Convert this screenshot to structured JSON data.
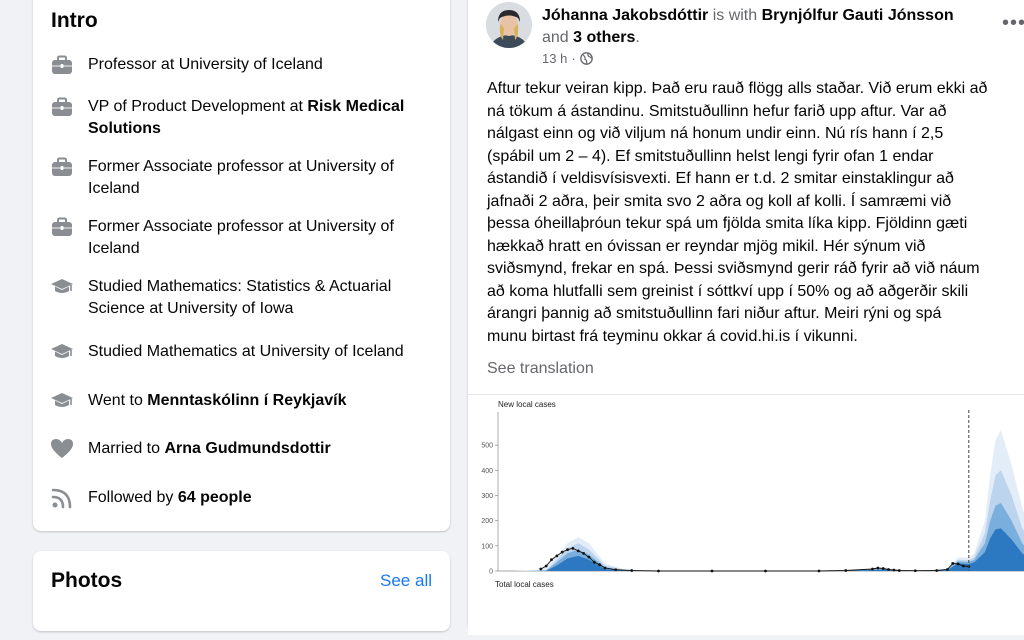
{
  "intro": {
    "title": "Intro",
    "items": [
      {
        "icon": "briefcase-icon",
        "text": "Professor at University of Iceland",
        "bold": ""
      },
      {
        "icon": "briefcase-icon",
        "text": "VP of Product Development at ",
        "bold": "Risk Medical Solutions"
      },
      {
        "icon": "briefcase-icon",
        "text": "Former Associate professor at University of Iceland",
        "bold": ""
      },
      {
        "icon": "briefcase-icon",
        "text": "Former Associate professor at University of Iceland",
        "bold": ""
      },
      {
        "icon": "graduation-cap-icon",
        "text": "Studied Mathematics: Statistics & Actuarial Science at University of Iowa",
        "bold": ""
      },
      {
        "icon": "graduation-cap-icon",
        "text": "Studied Mathematics at University of Iceland",
        "bold": ""
      },
      {
        "icon": "graduation-cap-icon",
        "text": "Went to ",
        "bold": "Menntaskólinn í Reykjavík"
      },
      {
        "icon": "heart-icon",
        "text": "Married to ",
        "bold": "Arna Gudmundsdottir"
      },
      {
        "icon": "rss-icon",
        "text": "Followed by ",
        "bold": "64 people"
      }
    ]
  },
  "photos": {
    "title": "Photos",
    "see_all": "See all"
  },
  "post": {
    "author": "Jóhanna Jakobsdóttir",
    "with_text": " is with ",
    "tagged": "Brynjólfur Gauti Jónsson",
    "and_text": "and ",
    "others": "3 others",
    "period": ".",
    "time": "13 h",
    "dot": "·",
    "more": "•••",
    "body_lines": [
      "Aftur tekur veiran kipp. Það eru rauð flögg alls staðar. Við erum ekki að",
      "ná tökum á ástandinu. Smitstuðullinn hefur farið upp aftur. Var að",
      "nálgast einn og við viljum ná honum undir einn. Nú rís hann í 2,5",
      "(spábil um 2 – 4). Ef smitstuðullinn helst lengi fyrir ofan 1 endar",
      "ástandið í veldisvísisvexti. Ef hann er t.d. 2 smitar einstaklingur að",
      "jafnaði 2 aðra, þeir smita svo 2 aðra og koll af kolli. Í samræmi við",
      "þessa óheillaþróun tekur spá um fjölda smita líka kipp. Fjöldinn gæti",
      "hækkað hratt en óvissan er reyndar mjög mikil. Hér sýnum við",
      "sviðsmynd, frekar en spá. Þessi sviðsmynd gerir ráð fyrir að við náum",
      "að koma hlutfalli sem greinist í sóttkví upp í 50% og að aðgerðir skili",
      "árangri þannig að smitstuðullinn fari niður aftur. Meiri rýni og spá",
      "munu birtast frá teyminu okkar á covid.hi.is í vikunni."
    ],
    "see_translation": "See translation"
  },
  "chart_data": {
    "type": "area",
    "title": "New local cases",
    "bottom_label": "Total local cases",
    "xlabel": "",
    "ylabel": "",
    "ylim": [
      0,
      600
    ],
    "yticks": [
      0,
      100,
      200,
      300,
      400,
      500
    ],
    "grid": false,
    "x_range": [
      0,
      100
    ],
    "forecast_start_x": 88,
    "bands": [
      {
        "name": "",
        "color": "#e3edf8",
        "points": [
          [
            3,
            0
          ],
          [
            8,
            4
          ],
          [
            11,
            60
          ],
          [
            13,
            110
          ],
          [
            15,
            135
          ],
          [
            17,
            110
          ],
          [
            20,
            30
          ],
          [
            24,
            4
          ],
          [
            30,
            0
          ],
          [
            60,
            0
          ],
          [
            66,
            3
          ],
          [
            72,
            12
          ],
          [
            75,
            4
          ],
          [
            80,
            2
          ],
          [
            84,
            10
          ],
          [
            86,
            55
          ],
          [
            88,
            52
          ],
          [
            89,
            70
          ],
          [
            91,
            200
          ],
          [
            92,
            380
          ],
          [
            93,
            520
          ],
          [
            94,
            560
          ],
          [
            96,
            420
          ],
          [
            98,
            250
          ],
          [
            100,
            140
          ],
          [
            100,
            0
          ]
        ]
      },
      {
        "name": "",
        "color": "#bcd4ee",
        "points": [
          [
            4,
            0
          ],
          [
            9,
            3
          ],
          [
            11,
            45
          ],
          [
            13,
            90
          ],
          [
            15,
            110
          ],
          [
            17,
            85
          ],
          [
            20,
            22
          ],
          [
            24,
            3
          ],
          [
            30,
            0
          ],
          [
            60,
            0
          ],
          [
            66,
            2
          ],
          [
            72,
            10
          ],
          [
            75,
            3
          ],
          [
            80,
            1
          ],
          [
            84,
            8
          ],
          [
            86,
            45
          ],
          [
            88,
            42
          ],
          [
            89,
            55
          ],
          [
            91,
            150
          ],
          [
            92,
            280
          ],
          [
            93,
            380
          ],
          [
            94,
            400
          ],
          [
            96,
            300
          ],
          [
            98,
            170
          ],
          [
            100,
            95
          ],
          [
            100,
            0
          ]
        ]
      },
      {
        "name": "",
        "color": "#7aaedc",
        "points": [
          [
            5,
            0
          ],
          [
            9,
            2
          ],
          [
            11,
            35
          ],
          [
            13,
            70
          ],
          [
            15,
            85
          ],
          [
            17,
            65
          ],
          [
            20,
            15
          ],
          [
            24,
            2
          ],
          [
            30,
            0
          ],
          [
            60,
            0
          ],
          [
            66,
            2
          ],
          [
            72,
            8
          ],
          [
            75,
            2
          ],
          [
            80,
            1
          ],
          [
            84,
            6
          ],
          [
            86,
            38
          ],
          [
            88,
            36
          ],
          [
            89,
            45
          ],
          [
            91,
            110
          ],
          [
            92,
            200
          ],
          [
            93,
            260
          ],
          [
            94,
            270
          ],
          [
            96,
            200
          ],
          [
            98,
            110
          ],
          [
            100,
            60
          ],
          [
            100,
            0
          ]
        ]
      },
      {
        "name": "",
        "color": "#2d79c1",
        "points": [
          [
            6,
            0
          ],
          [
            9,
            1
          ],
          [
            11,
            22
          ],
          [
            13,
            50
          ],
          [
            15,
            60
          ],
          [
            17,
            45
          ],
          [
            20,
            8
          ],
          [
            24,
            1
          ],
          [
            30,
            0
          ],
          [
            60,
            0
          ],
          [
            66,
            1
          ],
          [
            72,
            6
          ],
          [
            75,
            1
          ],
          [
            80,
            0
          ],
          [
            84,
            4
          ],
          [
            86,
            30
          ],
          [
            88,
            28
          ],
          [
            89,
            34
          ],
          [
            91,
            75
          ],
          [
            92,
            130
          ],
          [
            93,
            165
          ],
          [
            94,
            170
          ],
          [
            96,
            125
          ],
          [
            98,
            70
          ],
          [
            100,
            38
          ],
          [
            100,
            0
          ]
        ]
      }
    ],
    "observed": {
      "name": "",
      "x": [
        8,
        9,
        10,
        11,
        12,
        13,
        14,
        15,
        16,
        17,
        18,
        19,
        20,
        22,
        25,
        30,
        40,
        50,
        60,
        65,
        70,
        71,
        72,
        73,
        74,
        75,
        78,
        82,
        84,
        85,
        86,
        87,
        88
      ],
      "y": [
        8,
        20,
        45,
        60,
        75,
        85,
        90,
        80,
        70,
        55,
        35,
        25,
        12,
        5,
        2,
        0,
        0,
        0,
        0,
        2,
        8,
        12,
        10,
        6,
        4,
        2,
        1,
        2,
        6,
        30,
        28,
        20,
        18
      ]
    }
  }
}
